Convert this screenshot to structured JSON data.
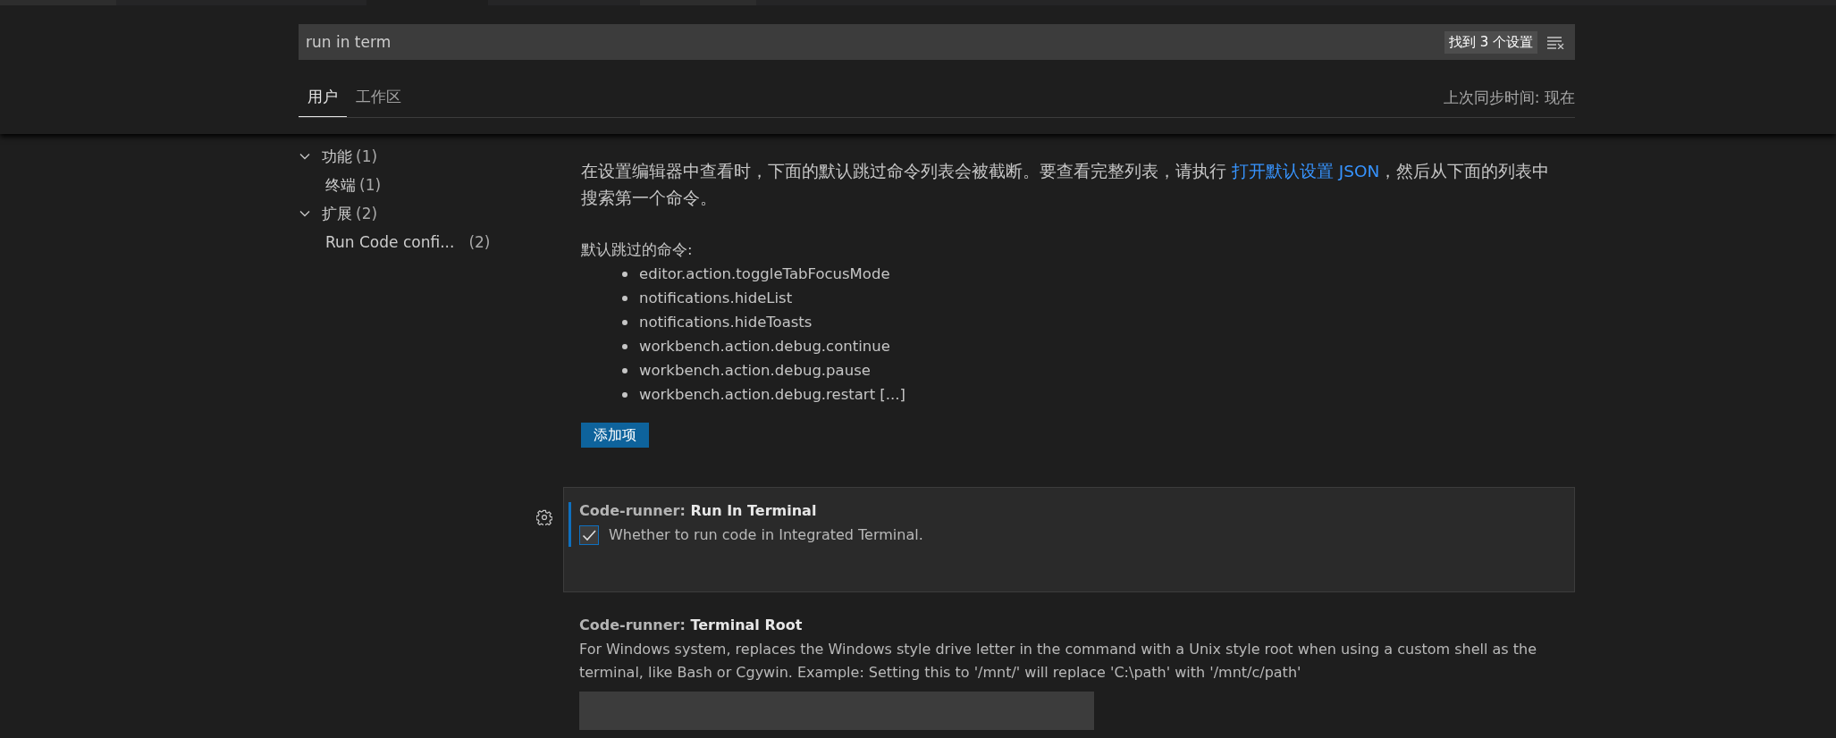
{
  "search": {
    "value": "run in term",
    "result_badge": "找到 3 个设置"
  },
  "tabs": [
    {
      "label": "用户",
      "selected": true
    },
    {
      "label": "工作区",
      "selected": false
    }
  ],
  "sync_status": "上次同步时间: 现在",
  "toc": [
    {
      "label": "功能",
      "count": "(1)",
      "expanded": true,
      "children": [
        {
          "label": "终端",
          "count": "(1)"
        }
      ]
    },
    {
      "label": "扩展",
      "count": "(2)",
      "expanded": true,
      "children": [
        {
          "label": "Run Code confi...",
          "count": "(2)"
        }
      ]
    }
  ],
  "intro": {
    "before": "在设置编辑器中查看时，下面的默认跳过命令列表会被截断。要查看完整列表，请执行 ",
    "link": "打开默认设置 JSON",
    "after": "，然后从下面的列表中搜索第一个命令。"
  },
  "commands_label": "默认跳过的命令:",
  "commands": [
    "editor.action.toggleTabFocusMode",
    "notifications.hideList",
    "notifications.hideToasts",
    "workbench.action.debug.continue",
    "workbench.action.debug.pause",
    "workbench.action.debug.restart [...]"
  ],
  "add_button": "添加项",
  "settings": [
    {
      "kind": "checkbox",
      "category": "Code-runner: ",
      "title": "Run In Terminal",
      "description": "Whether to run code in Integrated Terminal.",
      "checked": true,
      "focused": true
    },
    {
      "kind": "text",
      "category": "Code-runner: ",
      "title": "Terminal Root",
      "description": "For Windows system, replaces the Windows style drive letter in the command with a Unix style root when using a custom shell as the terminal, like Bash or Cgywin. Example: Setting this to '/mnt/' will replace 'C:\\path' with '/mnt/c/path'",
      "focused": false
    }
  ]
}
